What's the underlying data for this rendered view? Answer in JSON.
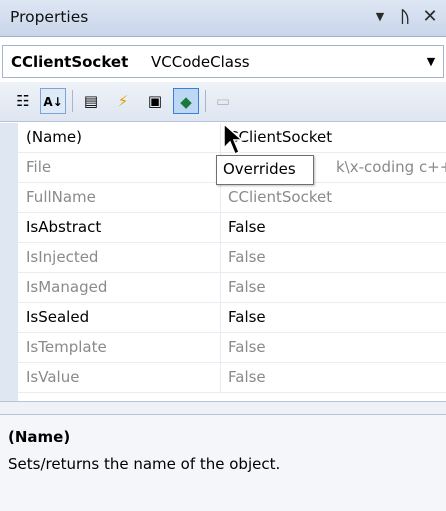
{
  "titlebar": {
    "title": "Properties",
    "dropdown_icon": "chevron-down-icon",
    "pin_icon": "pin-icon",
    "close_icon": "close-icon"
  },
  "object_selector": {
    "name": "CClientSocket",
    "type": "VCCodeClass"
  },
  "toolbar": {
    "buttons": [
      {
        "name": "categorized-icon",
        "glyph": "☷"
      },
      {
        "name": "alphabetical-icon",
        "glyph": "A↓"
      },
      {
        "name": "properties-icon",
        "glyph": "▤"
      },
      {
        "name": "events-icon",
        "glyph": "⚡"
      },
      {
        "name": "messages-icon",
        "glyph": "▣"
      },
      {
        "name": "overrides-icon",
        "glyph": "◆"
      },
      {
        "name": "property-pages-icon",
        "glyph": "▭"
      }
    ]
  },
  "grid": {
    "rows": [
      {
        "name": "(Name)",
        "value": "CClientSocket",
        "dim": false
      },
      {
        "name": "File",
        "value": "k\\x-coding c++",
        "dim": true
      },
      {
        "name": "FullName",
        "value": "CClientSocket",
        "dim": true
      },
      {
        "name": "IsAbstract",
        "value": "False",
        "dim": false
      },
      {
        "name": "IsInjected",
        "value": "False",
        "dim": true
      },
      {
        "name": "IsManaged",
        "value": "False",
        "dim": true
      },
      {
        "name": "IsSealed",
        "value": "False",
        "dim": false
      },
      {
        "name": "IsTemplate",
        "value": "False",
        "dim": true
      },
      {
        "name": "IsValue",
        "value": "False",
        "dim": true
      }
    ]
  },
  "tooltip": {
    "text": "Overrides"
  },
  "description": {
    "title": "(Name)",
    "text": "Sets/returns the name of the object."
  },
  "colors": {
    "accent": "#3c7fd8",
    "dim_text": "#8a8a8a"
  }
}
